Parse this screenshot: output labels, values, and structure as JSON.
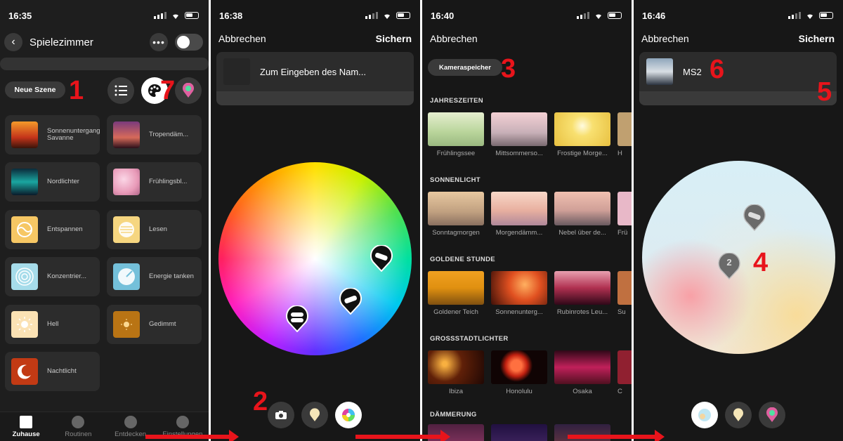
{
  "colors": {
    "annotation": "#e8141b",
    "bg": "#171717",
    "card": "#2c2c2c"
  },
  "screen1": {
    "time": "16:35",
    "room_title": "Spielezimmer",
    "new_scene": "Neue Szene",
    "scenes": [
      "Sonnenuntergang Savanne",
      "Tropendäm...",
      "Nordlichter",
      "Frühlingsbl...",
      "Entspannen",
      "Lesen",
      "Konzentrier...",
      "Energie tanken",
      "Hell",
      "Gedimmt",
      "Nachtlicht"
    ],
    "tabs": [
      "Zuhause",
      "Routinen",
      "Entdecken",
      "Einstellungen"
    ]
  },
  "screen2": {
    "time": "16:38",
    "cancel": "Abbrechen",
    "save": "Sichern",
    "name_placeholder": "Zum Eingeben des Nam..."
  },
  "screen3": {
    "time": "16:40",
    "cancel": "Abbrechen",
    "camera_roll": "Kameraspeicher",
    "sections": [
      {
        "title": "JAHRESZEITEN",
        "items": [
          "Frühlingssee",
          "Mittsommerso...",
          "Frostige Morge...",
          "H"
        ]
      },
      {
        "title": "SONNENLICHT",
        "items": [
          "Sonntagmorgen",
          "Morgendämm...",
          "Nebel über de...",
          "Frü"
        ]
      },
      {
        "title": "GOLDENE STUNDE",
        "items": [
          "Goldener Teich",
          "Sonnenunterg...",
          "Rubinrotes Leu...",
          "Su"
        ]
      },
      {
        "title": "GROSSSTADTLICHTER",
        "items": [
          "Ibiza",
          "Honolulu",
          "Osaka",
          "C"
        ]
      },
      {
        "title": "DÄMMERUNG",
        "items": []
      }
    ]
  },
  "screen4": {
    "time": "16:46",
    "cancel": "Abbrechen",
    "save": "Sichern",
    "scene_name": "MS2",
    "pin_label": "2"
  },
  "annotations": [
    "1",
    "7",
    "2",
    "3",
    "6",
    "5",
    "4"
  ]
}
